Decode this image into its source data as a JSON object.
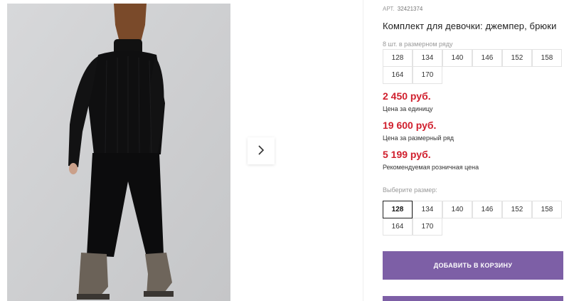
{
  "product": {
    "art_label": "АРТ.",
    "art_value": "32421374",
    "title": "Комплект для девочки: джемпер, брюки"
  },
  "size_row": {
    "label": "8 шт. в размерном ряду",
    "sizes": [
      "128",
      "134",
      "140",
      "146",
      "152",
      "158",
      "164",
      "170"
    ]
  },
  "prices": {
    "unit_price": "2 450 руб.",
    "unit_note": "Цена за единицу",
    "row_price": "19 600 руб.",
    "row_note": "Цена за размерный ряд",
    "retail_price": "5 199 руб.",
    "retail_note": "Рекомендуемая розничная цена"
  },
  "size_select": {
    "label": "Выберите размер:",
    "sizes": [
      "128",
      "134",
      "140",
      "146",
      "152",
      "158",
      "164",
      "170"
    ],
    "selected": "128"
  },
  "cart": {
    "add_label": "ДОБАВИТЬ В КОРЗИНУ"
  },
  "colors": {
    "price_red": "#d01f2d",
    "button_purple": "#7d5fa6"
  },
  "icons": {
    "next": "chevron-right-icon"
  }
}
